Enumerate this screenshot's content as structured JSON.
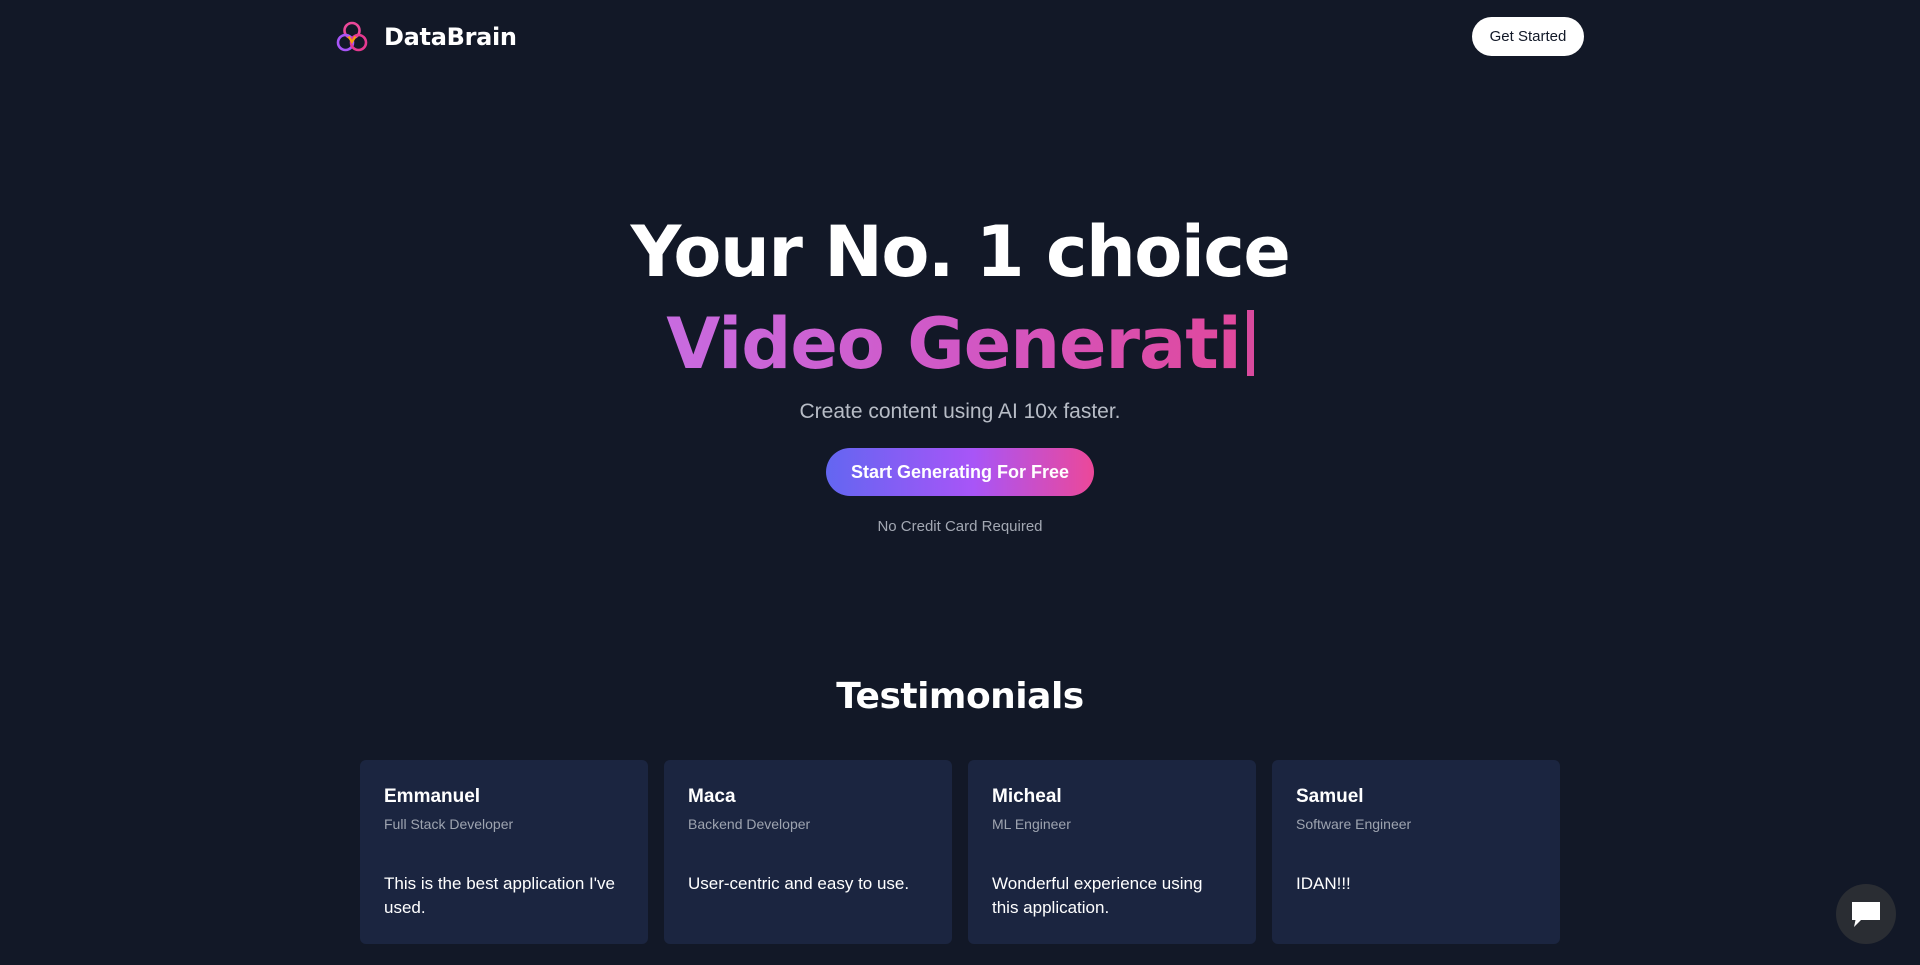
{
  "nav": {
    "brand_name": "DataBrain",
    "logo_icon": "triple-ring-logo-icon",
    "cta_label": "Get Started"
  },
  "hero": {
    "title": "Your No. 1 choice",
    "typed_text": "Video Generati",
    "subtitle": "Create content using AI 10x faster.",
    "cta_label": "Start Generating For Free",
    "cta_note": "No Credit Card Required"
  },
  "testimonials": {
    "title": "Testimonials",
    "items": [
      {
        "name": "Emmanuel",
        "role": "Full Stack Developer",
        "quote": "This is the best application I've used."
      },
      {
        "name": "Maca",
        "role": "Backend Developer",
        "quote": "User-centric and easy to use."
      },
      {
        "name": "Micheal",
        "role": "ML Engineer",
        "quote": "Wonderful experience using this application."
      },
      {
        "name": "Samuel",
        "role": "Software Engineer",
        "quote": "IDAN!!!"
      }
    ]
  },
  "chat_widget": {
    "icon": "chat-bubble-icon"
  },
  "colors": {
    "background": "#121827",
    "card": "#1b2540",
    "gradient_start": "#6366f1",
    "gradient_end": "#ec4899",
    "typed_gradient": [
      "#c86be0",
      "#e0489c"
    ]
  }
}
